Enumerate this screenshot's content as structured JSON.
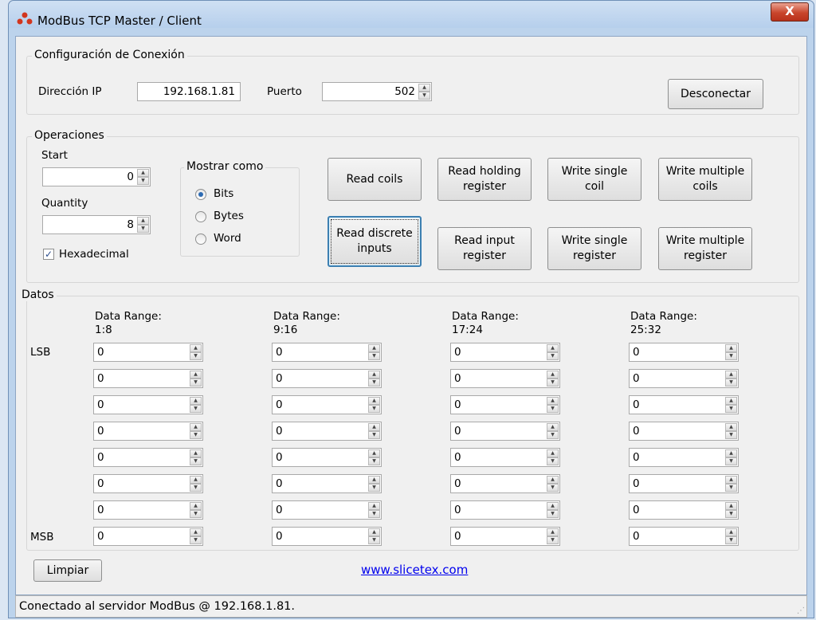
{
  "window": {
    "title": "ModBus TCP Master / Client",
    "close_label": "X"
  },
  "conexion": {
    "legend": "Configuración de Conexión",
    "ip_label": "Dirección IP",
    "ip_value": "192.168.1.81",
    "port_label": "Puerto",
    "port_value": "502",
    "disconnect_label": "Desconectar"
  },
  "operaciones": {
    "legend": "Operaciones",
    "start_label": "Start",
    "start_value": "0",
    "quantity_label": "Quantity",
    "quantity_value": "8",
    "hex_label": "Hexadecimal",
    "hex_checked": true,
    "mostrar": {
      "legend": "Mostrar como",
      "options": [
        "Bits",
        "Bytes",
        "Word"
      ],
      "selected": "Bits"
    },
    "buttons": [
      "Read coils",
      "Read holding\nregister",
      "Write single\ncoil",
      "Write multiple\ncoils",
      "Read discrete\ninputs",
      "Read input\nregister",
      "Write single\nregister",
      "Write multiple\nregister"
    ]
  },
  "datos": {
    "legend": "Datos",
    "lsb_label": "LSB",
    "msb_label": "MSB",
    "range_title": "Data Range:",
    "columns": [
      {
        "range": "1:8",
        "values": [
          "0",
          "0",
          "0",
          "0",
          "0",
          "0",
          "0",
          "0"
        ]
      },
      {
        "range": "9:16",
        "values": [
          "0",
          "0",
          "0",
          "0",
          "0",
          "0",
          "0",
          "0"
        ]
      },
      {
        "range": "17:24",
        "values": [
          "0",
          "0",
          "0",
          "0",
          "0",
          "0",
          "0",
          "0"
        ]
      },
      {
        "range": "25:32",
        "values": [
          "0",
          "0",
          "0",
          "0",
          "0",
          "0",
          "0",
          "0"
        ]
      }
    ],
    "clear_label": "Limpiar",
    "link": "www.slicetex.com"
  },
  "status": {
    "text": "Conectado al servidor ModBus @ 192.168.1.81."
  },
  "colors": {
    "window_frame": "#bcd3ec",
    "client": "#f0f0f0",
    "close": "#c9452c",
    "link": "#0000ee"
  }
}
